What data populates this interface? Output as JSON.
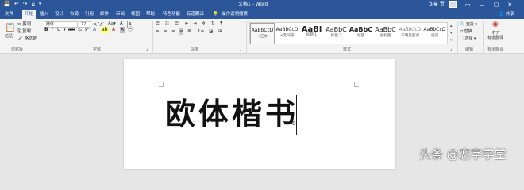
{
  "titlebar": {
    "title": "文档1 - Word",
    "user": "沈蔓 贾",
    "qat": [
      "💾",
      "↶",
      "↷",
      "⌂",
      "▾"
    ],
    "window_buttons": [
      "▭",
      "—",
      "▢",
      "✕"
    ],
    "accent": "#2b579a"
  },
  "tabs": [
    "文件",
    "开始",
    "插入",
    "设计",
    "布局",
    "引用",
    "邮件",
    "审阅",
    "视图",
    "帮助",
    "特色功能",
    "有道翻译"
  ],
  "active_tab": "开始",
  "tell_me": "操作说明搜索",
  "share": "共享",
  "ribbon": {
    "clipboard": {
      "paste": "粘贴",
      "cut": "剪切",
      "copy": "复制",
      "format_painter": "格式刷",
      "label": "剪贴板"
    },
    "font": {
      "name": "楷体",
      "size": "72",
      "label": "字体"
    },
    "paragraph": {
      "label": "段落"
    },
    "styles": {
      "label": "样式",
      "items": [
        {
          "preview": "AaBbCcD",
          "name": "+正文"
        },
        {
          "preview": "AaBbCcD",
          "name": "+无间隔"
        },
        {
          "preview": "AaBl",
          "name": "标题 1"
        },
        {
          "preview": "AaBbC",
          "name": "标题 2"
        },
        {
          "preview": "AaBbC",
          "name": "标题"
        },
        {
          "preview": "AaBbC",
          "name": "副标题"
        },
        {
          "preview": "AaBbCcD",
          "name": "不明显强调"
        },
        {
          "preview": "AaBbCcD",
          "name": "强调"
        }
      ]
    },
    "editing": {
      "find": "查找",
      "replace": "替换",
      "select": "选择",
      "label": "编辑"
    },
    "translate": {
      "line1": "打开",
      "line2": "有道翻译",
      "label": "有道翻译"
    }
  },
  "document": {
    "text": "欧体楷书"
  },
  "watermark": "头条 @恋字学堂"
}
